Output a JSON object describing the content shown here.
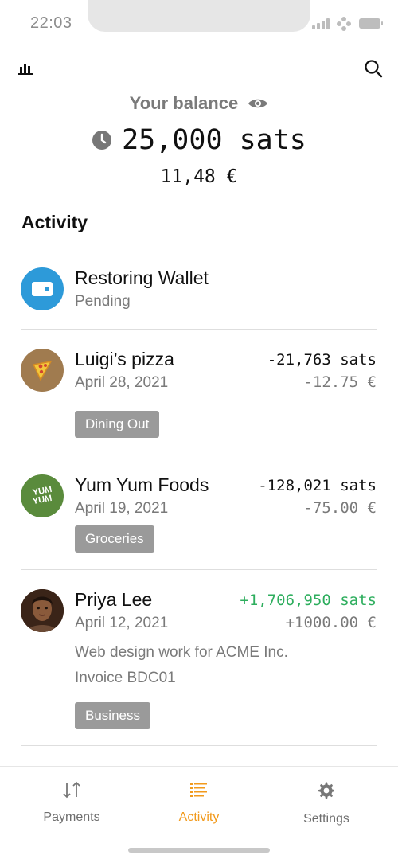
{
  "status_bar": {
    "time": "22:03"
  },
  "header": {
    "stats_icon": "bar-chart-icon",
    "search_icon": "search-icon"
  },
  "balance": {
    "label": "Your balance",
    "amount": "25,000 sats",
    "fiat": "11,48 €"
  },
  "activity": {
    "title": "Activity",
    "items": [
      {
        "name": "Restoring Wallet",
        "sub": "Pending",
        "icon": "wallet-icon"
      },
      {
        "name": "Luigi’s pizza",
        "date": "April 28, 2021",
        "amount": "-21,763 sats",
        "fiat": "-12.75 €",
        "tag": "Dining Out",
        "icon": "pizza-icon"
      },
      {
        "name": "Yum Yum Foods",
        "date": "April 19, 2021",
        "amount": "-128,021 sats",
        "fiat": "-75.00 €",
        "tag": "Groceries",
        "logo_text_1": "YUM",
        "logo_text_2": "YUM"
      },
      {
        "name": "Priya Lee",
        "date": "April 12, 2021",
        "amount": "+1,706,950 sats",
        "fiat": "+1000.00 €",
        "memo_1": "Web design work for ACME Inc.",
        "memo_2": "Invoice BDC01",
        "tag": "Business"
      }
    ]
  },
  "nav": {
    "payments": "Payments",
    "activity": "Activity",
    "settings": "Settings"
  },
  "colors": {
    "accent": "#f29a1c",
    "positive": "#2eae5e",
    "wallet_blue": "#2d9ad9",
    "yum_green": "#5a8b3c",
    "pizza_brown": "#a07b4f"
  }
}
